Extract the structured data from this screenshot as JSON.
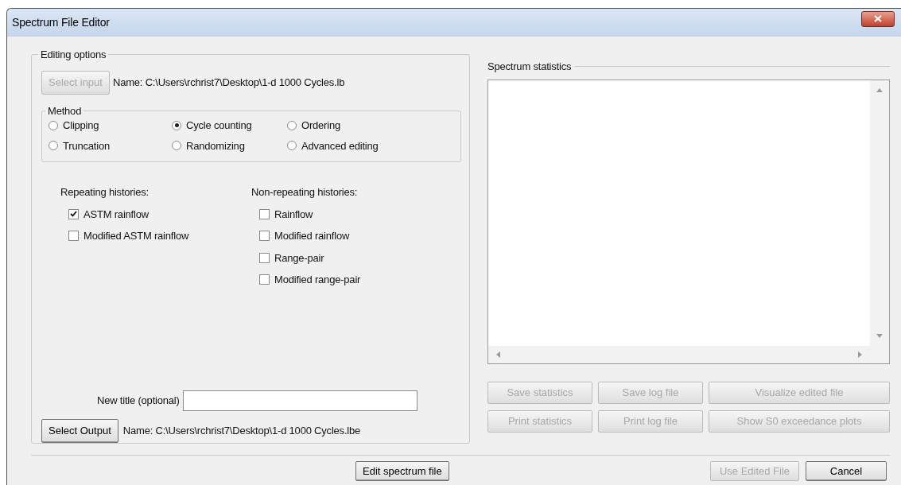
{
  "window": {
    "title": "Spectrum File Editor"
  },
  "editing_options": {
    "title": "Editing options",
    "select_input": {
      "label": "Select input",
      "disabled": true
    },
    "input_name": "Name: C:\\Users\\rchrist7\\Desktop\\1-d 1000 Cycles.lb",
    "method": {
      "title": "Method",
      "options": [
        {
          "label": "Clipping",
          "selected": false
        },
        {
          "label": "Cycle counting",
          "selected": true
        },
        {
          "label": "Ordering",
          "selected": false
        },
        {
          "label": "Truncation",
          "selected": false
        },
        {
          "label": "Randomizing",
          "selected": false
        },
        {
          "label": "Advanced editing",
          "selected": false
        }
      ]
    },
    "repeating": {
      "title": "Repeating histories:",
      "options": [
        {
          "label": "ASTM rainflow",
          "checked": true
        },
        {
          "label": "Modified ASTM rainflow",
          "checked": false
        }
      ]
    },
    "non_repeating": {
      "title": "Non-repeating histories:",
      "options": [
        {
          "label": "Rainflow",
          "checked": false
        },
        {
          "label": "Modified rainflow",
          "checked": false
        },
        {
          "label": "Range-pair",
          "checked": false
        },
        {
          "label": "Modified range-pair",
          "checked": false
        }
      ]
    },
    "new_title": {
      "label": "New title (optional)"
    },
    "select_output": {
      "label": "Select Output",
      "disabled": false
    },
    "output_name": "Name: C:\\Users\\rchrist7\\Desktop\\1-d 1000 Cycles.lbe"
  },
  "statistics": {
    "title": "Spectrum statistics",
    "buttons": [
      {
        "label": "Save statistics",
        "disabled": true
      },
      {
        "label": "Save log file",
        "disabled": true
      },
      {
        "label": "Visualize edited file",
        "disabled": true
      },
      {
        "label": "Print statistics",
        "disabled": true
      },
      {
        "label": "Print log file",
        "disabled": true
      },
      {
        "label": "Show S0 exceedance plots",
        "disabled": true
      }
    ]
  },
  "footer_buttons": [
    {
      "label": "Edit spectrum file",
      "disabled": false
    },
    {
      "label": "Use Edited File",
      "disabled": true
    },
    {
      "label": "Cancel",
      "disabled": false
    }
  ]
}
